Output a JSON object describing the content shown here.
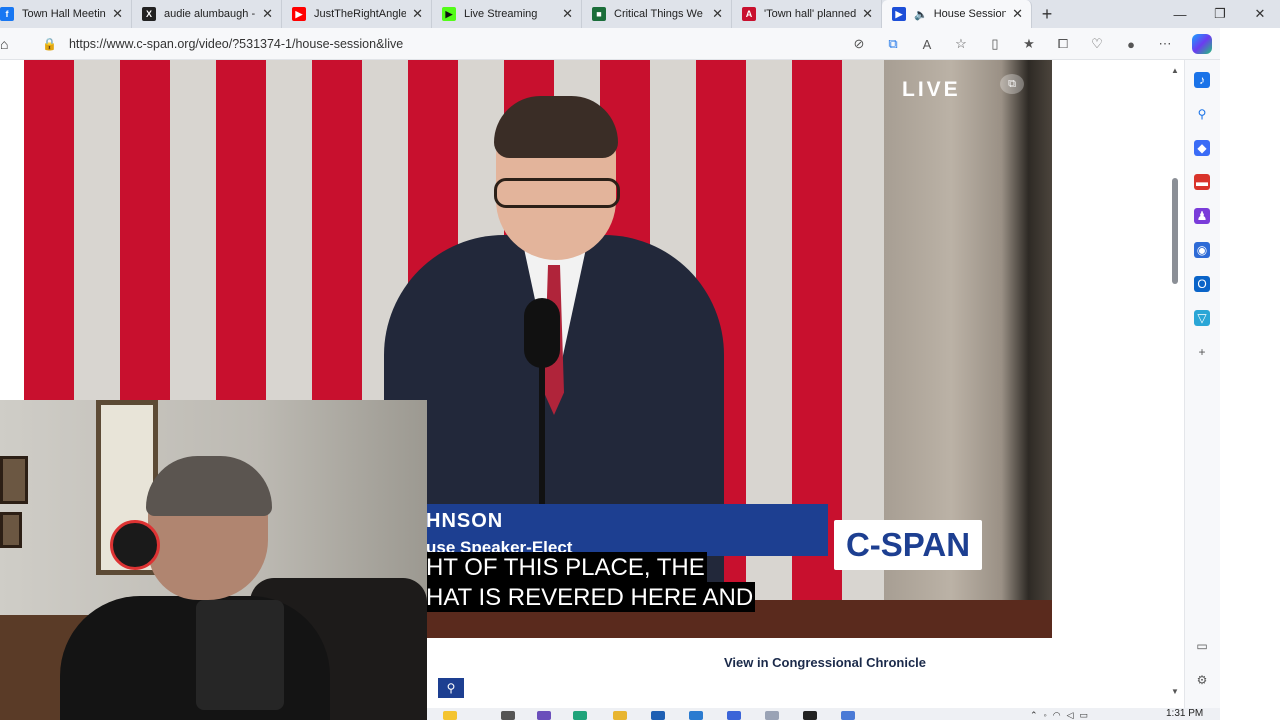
{
  "browser": {
    "tabs": [
      {
        "title": "Town Hall Meeting - F",
        "favicon_color": "#1877f2",
        "favicon_glyph": "f",
        "active": false
      },
      {
        "title": "audie alumbaugh - S",
        "favicon_color": "#222222",
        "favicon_glyph": "X",
        "active": false
      },
      {
        "title": "JustTheRightAngle o",
        "favicon_color": "#ff0000",
        "favicon_glyph": "▶",
        "active": false
      },
      {
        "title": "Live Streaming",
        "favicon_color": "#53fc18",
        "favicon_glyph": "▶",
        "active": false
      },
      {
        "title": "Critical Things We Ne",
        "favicon_color": "#1b6e3a",
        "favicon_glyph": "■",
        "active": false
      },
      {
        "title": "'Town hall' planned t",
        "favicon_color": "#c8102e",
        "favicon_glyph": "A",
        "active": false
      },
      {
        "title": "House Session |",
        "favicon_color": "#1d4fd8",
        "favicon_glyph": "▶",
        "active": true
      }
    ],
    "new_tab_label": "+",
    "window_controls": {
      "minimize": "—",
      "restore": "❐",
      "close": "✕"
    },
    "url": "https://www.c-span.org/video/?531374-1/house-session&live"
  },
  "video": {
    "live_badge": "LIVE",
    "lower_third_name": "HNSON",
    "lower_third_title": "use Speaker-Elect",
    "network_logo": "C-SPAN",
    "caption_line1": "HT OF THIS PLACE, THE",
    "caption_line2": "HAT IS REVERED HERE AND"
  },
  "page": {
    "chronicle_link": "View in Congressional Chronicle"
  },
  "taskbar": {
    "clock": "1:31 PM"
  },
  "colors": {
    "cspan_blue": "#1d3f91",
    "flag_red": "#c8102e"
  }
}
